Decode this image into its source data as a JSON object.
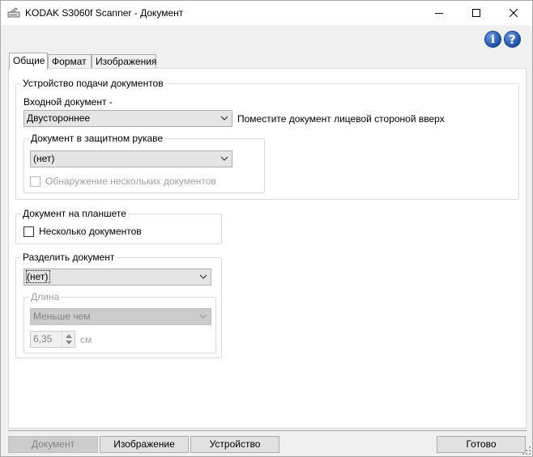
{
  "window": {
    "title": "KODAK S3060f Scanner - Документ",
    "icons": {
      "app": "scanner-icon",
      "minimize": "minimize-icon",
      "maximize": "maximize-icon",
      "close": "close-icon",
      "info": "info-icon",
      "help": "help-icon"
    }
  },
  "tabs": [
    {
      "label": "Общие",
      "active": true
    },
    {
      "label": "Формат",
      "active": false
    },
    {
      "label": "Изображения",
      "active": false
    }
  ],
  "feeder": {
    "legend": "Устройство подачи документов",
    "input_label": "Входной документ -",
    "input_value": "Двустороннее",
    "input_hint": "Поместите документ лицевой стороной вверх",
    "sleeve": {
      "legend": "Документ в защитном рукаве",
      "value": "(нет)",
      "multi_detect_label": "Обнаружение нескольких документов"
    }
  },
  "flatbed": {
    "legend": "Документ на планшете",
    "multi_label": "Несколько документов"
  },
  "split": {
    "legend": "Разделить документ",
    "value": "(нет)",
    "length": {
      "legend": "Длина",
      "mode_value": "Меньше чем",
      "amount": "6,35",
      "unit": "см"
    }
  },
  "buttons": {
    "document": "Документ",
    "image": "Изображение",
    "device": "Устройство",
    "done": "Готово"
  },
  "colors": {
    "accent_icon": "#1f4fa8",
    "disabled_text": "#a0a0a0"
  }
}
